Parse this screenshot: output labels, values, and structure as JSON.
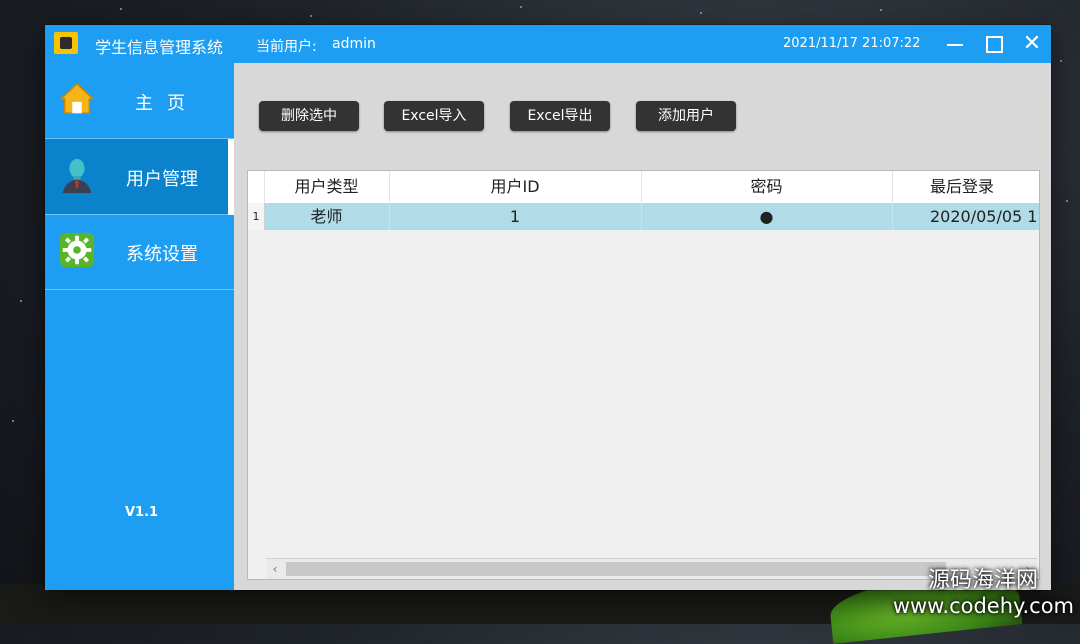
{
  "window": {
    "title": "学生信息管理系统",
    "current_user_label": "当前用户:",
    "current_user": "admin",
    "datetime": "2021/11/17 21:07:22",
    "controls": {
      "minimize": "minimize",
      "maximize": "maximize",
      "close": "✕"
    }
  },
  "sidebar": {
    "items": [
      {
        "label": "主页",
        "icon": "home-icon",
        "active": false
      },
      {
        "label": "用户管理",
        "icon": "user-avatar-icon",
        "active": true
      },
      {
        "label": "系统设置",
        "icon": "gear-icon",
        "active": false
      }
    ],
    "version": "V1.1"
  },
  "toolbar": {
    "delete_label": "删除选中",
    "import_label": "Excel导入",
    "export_label": "Excel导出",
    "add_label": "添加用户"
  },
  "table": {
    "columns": [
      "用户类型",
      "用户ID",
      "密码",
      "最后登录"
    ],
    "rows": [
      {
        "num": "1",
        "type": "老师",
        "id": "1",
        "password": "●",
        "last_login": "2020/05/05 1"
      }
    ]
  },
  "watermark": {
    "site_name": "源码海洋网",
    "url": "www.codehy.com"
  },
  "colors": {
    "accent": "#1e9ef2",
    "sidebar_active": "#0a82cc",
    "selected_row": "#b0dce8",
    "button_dark": "#333333"
  }
}
